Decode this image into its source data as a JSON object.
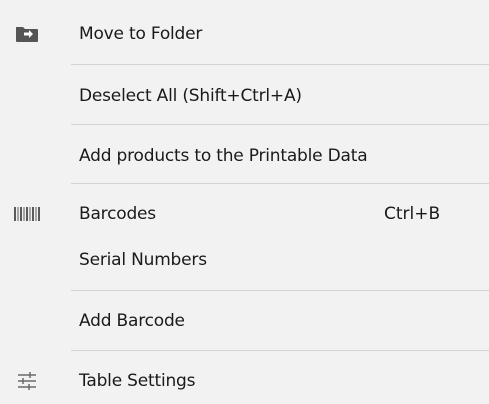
{
  "menu": {
    "items": [
      {
        "label": "Move to Folder",
        "shortcut": "",
        "icon": "move-to-folder-icon"
      },
      {
        "label": "Deselect All (Shift+Ctrl+A)",
        "shortcut": "",
        "icon": ""
      },
      {
        "label": "Add products to the Printable Data",
        "shortcut": "",
        "icon": ""
      },
      {
        "label": "Barcodes",
        "shortcut": "Ctrl+B",
        "icon": "barcode-icon"
      },
      {
        "label": "Serial Numbers",
        "shortcut": "",
        "icon": ""
      },
      {
        "label": "Add Barcode",
        "shortcut": "",
        "icon": ""
      },
      {
        "label": "Table Settings",
        "shortcut": "",
        "icon": "sliders-icon"
      }
    ]
  },
  "colors": {
    "background": "#f2f2f2",
    "text": "#1a1a1a",
    "separator": "#d4d4d4",
    "icon": "#5a5a5a"
  }
}
